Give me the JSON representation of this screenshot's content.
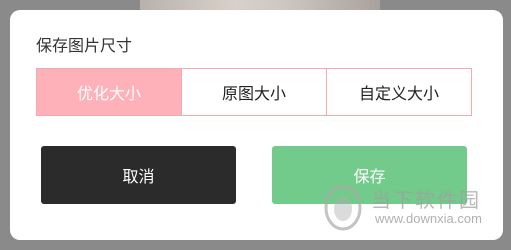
{
  "dialog": {
    "title": "保存图片尺寸",
    "size_options": [
      {
        "label": "优化大小",
        "selected": true
      },
      {
        "label": "原图大小",
        "selected": false
      },
      {
        "label": "自定义大小",
        "selected": false
      }
    ],
    "cancel_label": "取消",
    "save_label": "保存"
  },
  "watermark": {
    "name": "当下软件园",
    "url": "www.downxia.com"
  },
  "colors": {
    "accent_pink": "#ffb1ba",
    "segment_border": "#f4aab2",
    "cancel_button": "#2b2b2b",
    "save_button": "#72cb8a",
    "overlay": "#8a8a8a"
  }
}
